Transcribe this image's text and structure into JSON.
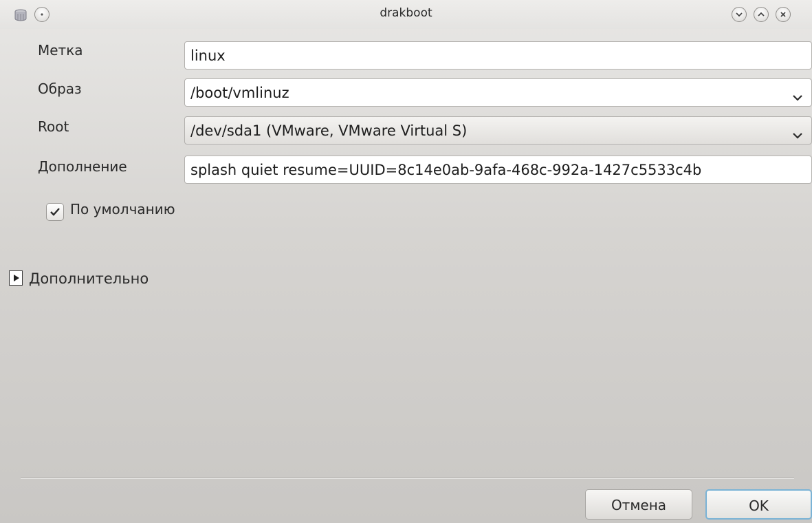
{
  "window": {
    "title": "drakboot",
    "app_icon": "disk-icon",
    "menu_icon": "circle-menu-icon",
    "buttons": [
      "minimize-icon",
      "maximize-icon",
      "close-icon"
    ]
  },
  "form": {
    "label_field": {
      "label": "Метка",
      "value": "linux"
    },
    "image_field": {
      "label": "Образ",
      "value": "/boot/vmlinuz"
    },
    "root_field": {
      "label": "Root",
      "value": "/dev/sda1 (VMware, VMware Virtual S)"
    },
    "append_field": {
      "label": "Дополнение",
      "value": "splash quiet resume=UUID=8c14e0ab-9afa-468c-992a-1427c5533c4b"
    },
    "default_checkbox": {
      "label": "По умолчанию",
      "checked": true
    }
  },
  "advanced": {
    "label": "Дополнительно",
    "expanded": false
  },
  "footer": {
    "cancel_label": "Отмена",
    "ok_label": "OK"
  },
  "colors": {
    "focus_accent": "#7ab3d6",
    "window_bg": "#d6d4d1"
  }
}
